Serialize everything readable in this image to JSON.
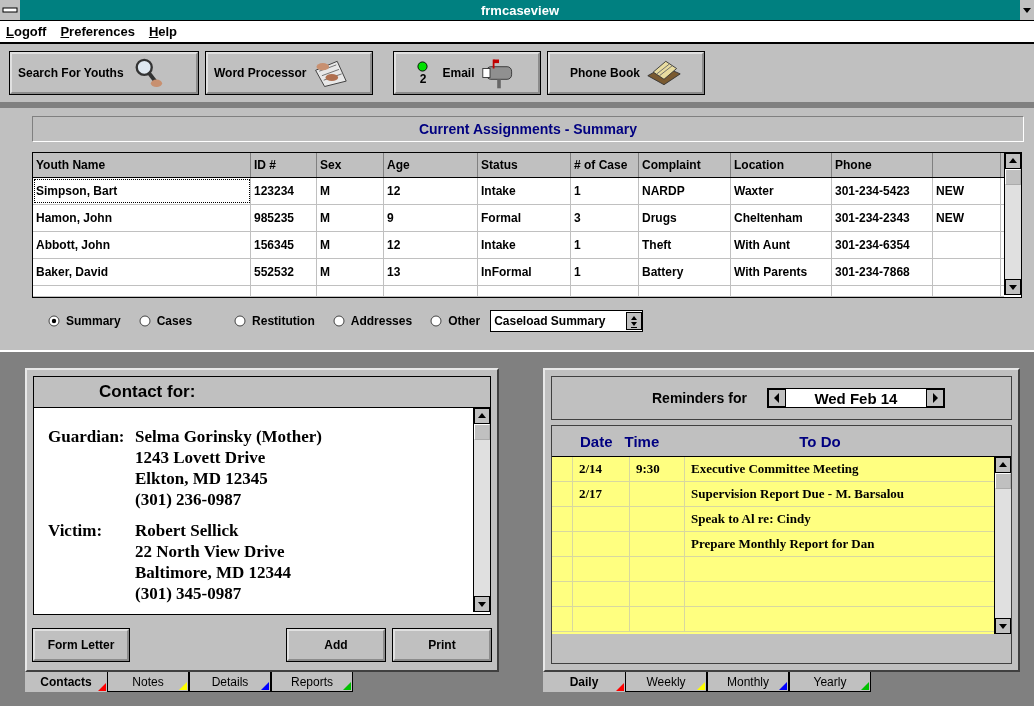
{
  "window": {
    "title": "frmcaseview"
  },
  "menu": [
    {
      "label": "Logoff"
    },
    {
      "label": "Preferences"
    },
    {
      "label": "Help"
    }
  ],
  "toolbar": [
    {
      "kind": "search",
      "label": "Search For Youths"
    },
    {
      "kind": "word",
      "label": "Word Processor"
    },
    {
      "kind": "email",
      "label": "Email",
      "count": "2"
    },
    {
      "kind": "phone",
      "label": "Phone Book"
    }
  ],
  "assignments": {
    "title": "Current Assignments - Summary",
    "columns": [
      "Youth Name",
      "ID #",
      "Sex",
      "Age",
      "Status",
      "# of Case",
      "Complaint",
      "Location",
      "Phone"
    ],
    "rows": [
      {
        "selected": true,
        "cells": [
          "Simpson, Bart",
          "123234",
          "M",
          "12",
          "Intake",
          "1",
          "NARDP",
          "Waxter",
          "301-234-5423",
          "NEW"
        ]
      },
      {
        "selected": false,
        "cells": [
          "Hamon, John",
          "985235",
          "M",
          "9",
          "Formal",
          "3",
          "Drugs",
          "Cheltenham",
          "301-234-2343",
          "NEW"
        ]
      },
      {
        "selected": false,
        "cells": [
          "Abbott, John",
          "156345",
          "M",
          "12",
          "Intake",
          "1",
          "Theft",
          "With Aunt",
          "301-234-6354",
          ""
        ]
      },
      {
        "selected": false,
        "cells": [
          "Baker, David",
          "552532",
          "M",
          "13",
          "InFormal",
          "1",
          "Battery",
          "With Parents",
          "301-234-7868",
          ""
        ]
      }
    ]
  },
  "view_options": [
    {
      "label": "Summary",
      "selected": true
    },
    {
      "label": "Cases",
      "selected": false
    },
    {
      "label": "Restitution",
      "selected": false
    },
    {
      "label": "Addresses",
      "selected": false
    },
    {
      "label": "Other",
      "selected": false
    }
  ],
  "view_select": {
    "value": "Caseload Summary"
  },
  "contact": {
    "title": "Contact for:",
    "entries": [
      {
        "role": "Guardian:",
        "lines": [
          "Selma Gorinsky (Mother)",
          "1243 Lovett Drive",
          "Elkton, MD 12345",
          "(301) 236-0987"
        ]
      },
      {
        "role": "Victim:",
        "lines": [
          "Robert Sellick",
          "22 North View Drive",
          "Baltimore, MD 12344",
          "(301) 345-0987"
        ]
      }
    ],
    "buttons": [
      "Form Letter",
      "Add",
      "Print"
    ],
    "tabs": [
      {
        "label": "Contacts",
        "selected": true,
        "color": "#ff0000"
      },
      {
        "label": "Notes",
        "selected": false,
        "color": "#ffff00"
      },
      {
        "label": "Details",
        "selected": false,
        "color": "#0000ff"
      },
      {
        "label": "Reports",
        "selected": false,
        "color": "#00c000"
      }
    ]
  },
  "reminders": {
    "label": "Reminders for",
    "date": "Wed  Feb 14",
    "columns": [
      "Date",
      "Time",
      "To Do"
    ],
    "rows": [
      {
        "date": "2/14",
        "time": "9:30",
        "todo": "Executive Committee Meeting"
      },
      {
        "date": "2/17",
        "time": "",
        "todo": "Supervision Report Due - M. Barsalou"
      },
      {
        "date": "",
        "time": "",
        "todo": "Speak to Al re: Cindy"
      },
      {
        "date": "",
        "time": "",
        "todo": "Prepare Monthly Report for Dan"
      }
    ],
    "tabs": [
      {
        "label": "Daily",
        "selected": true,
        "color": "#ff0000"
      },
      {
        "label": "Weekly",
        "selected": false,
        "color": "#ffff00"
      },
      {
        "label": "Monthly",
        "selected": false,
        "color": "#0000ff"
      },
      {
        "label": "Yearly",
        "selected": false,
        "color": "#00c000"
      }
    ]
  }
}
